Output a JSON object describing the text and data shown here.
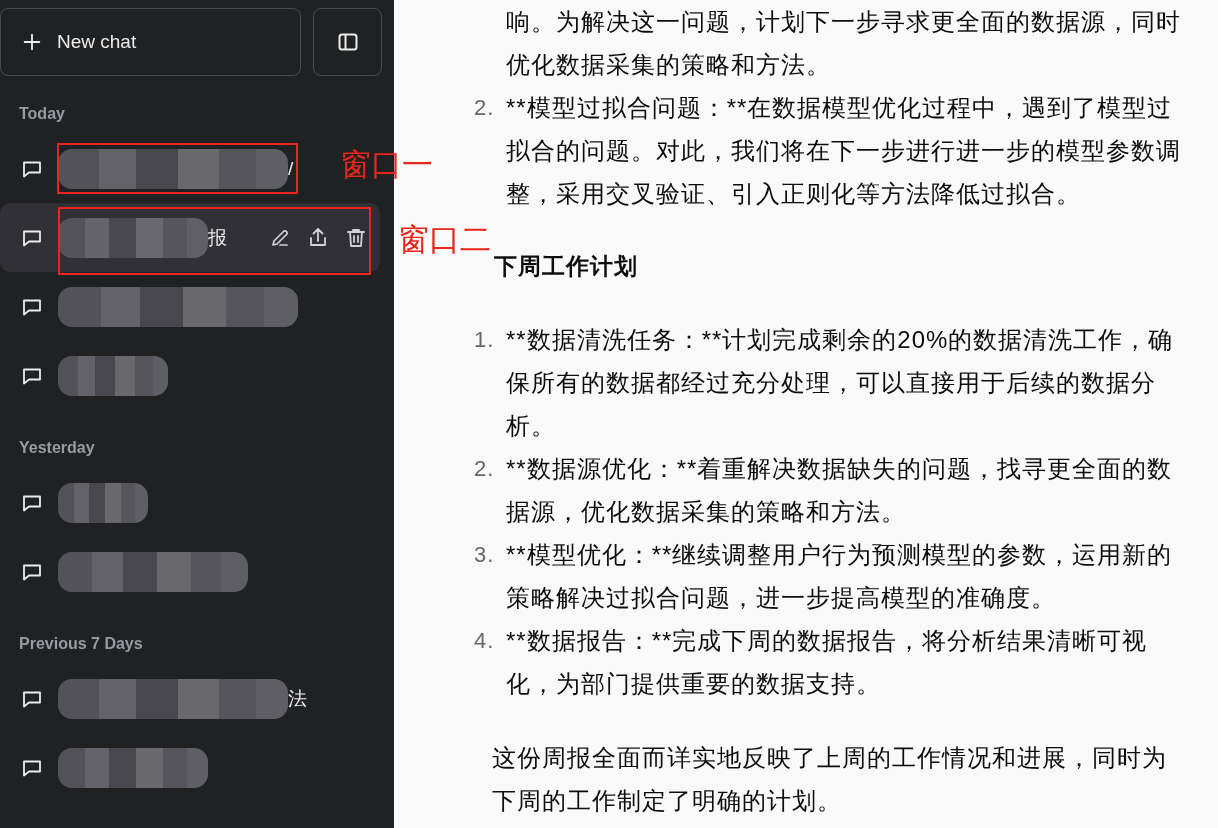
{
  "sidebar": {
    "new_chat_button": {
      "label": "New chat"
    },
    "groups": [
      {
        "heading": "Today",
        "chats": [
          {
            "visible_text": "/",
            "selected": false
          },
          {
            "visible_text": "报",
            "selected": true
          },
          {
            "selected": false
          },
          {
            "selected": false
          }
        ]
      },
      {
        "heading": "Yesterday",
        "chats": [
          {
            "selected": false
          },
          {
            "selected": false
          }
        ]
      },
      {
        "heading": "Previous 7 Days",
        "chats": [
          {
            "visible_text": "法",
            "selected": false
          },
          {
            "selected": false
          }
        ]
      }
    ]
  },
  "annotations": [
    {
      "label": "窗口一"
    },
    {
      "label": "窗口二"
    }
  ],
  "content": [
    {
      "kind": "list",
      "items": [
        {
          "text": "响。为解决这一问题，计划下一步寻求更全面的数据源，同时优化数据采集的策略和方法。"
        },
        {
          "number": "2.",
          "text": "**模型过拟合问题：**在数据模型优化过程中，遇到了模型过拟合的问题。对此，我们将在下一步进行进一步的模型参数调整，采用交叉验证、引入正则化等方法降低过拟合。"
        }
      ]
    },
    {
      "kind": "heading",
      "text": "下周工作计划"
    },
    {
      "kind": "list",
      "items": [
        {
          "number": "1.",
          "text": "**数据清洗任务：**计划完成剩余的20%的数据清洗工作，确保所有的数据都经过充分处理，可以直接用于后续的数据分析。"
        },
        {
          "number": "2.",
          "text": "**数据源优化：**着重解决数据缺失的问题，找寻更全面的数据源，优化数据采集的策略和方法。"
        },
        {
          "number": "3.",
          "text": "**模型优化：**继续调整用户行为预测模型的参数，运用新的策略解决过拟合问题，进一步提高模型的准确度。"
        },
        {
          "number": "4.",
          "text": "**数据报告：**完成下周的数据报告，将分析结果清晰可视化，为部门提供重要的数据支持。"
        }
      ]
    },
    {
      "kind": "paragraph",
      "text": "这份周报全面而详实地反映了上周的工作情况和进展，同时为下周的工作制定了明确的计划。"
    }
  ]
}
